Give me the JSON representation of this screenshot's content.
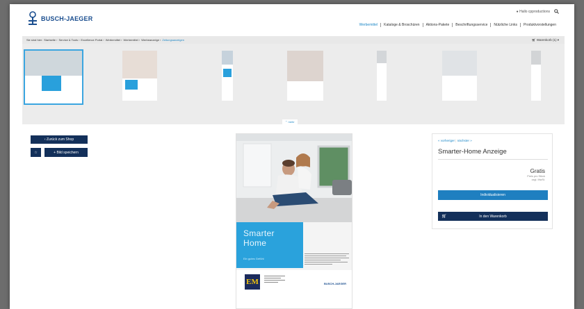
{
  "brand": {
    "name": "BUSCH-JAEGER",
    "color": "#1a4e8f"
  },
  "user": {
    "greeting": "Hallo cpproductions",
    "icon": "user-icon",
    "search_icon": "search-icon"
  },
  "main_nav": [
    {
      "label": "Werbemittel",
      "active": true
    },
    {
      "label": "Kataloge & Broschüren",
      "active": false
    },
    {
      "label": "Aktions-Pakete",
      "active": false
    },
    {
      "label": "Beschriftungsservice",
      "active": false
    },
    {
      "label": "Nützliche Links",
      "active": false
    },
    {
      "label": "Produktvorstellungen",
      "active": false
    }
  ],
  "breadcrumb": [
    {
      "label": "Sie sind hier:"
    },
    {
      "label": "Startseite ›"
    },
    {
      "label": "Service & Tools ›"
    },
    {
      "label": "Excellence Portal ›"
    },
    {
      "label": "Werbemittel ›"
    },
    {
      "label": "Werbemittel ›"
    },
    {
      "label": "Werbeanzeige ›"
    },
    {
      "label": "Zeitungsanzeigen",
      "current": true
    }
  ],
  "cart_top": "Warenkorb (1) ▾",
  "more_label": "⌃ mehr",
  "left_buttons": {
    "back": "‹ Zurück zum Shop",
    "star": "☆",
    "save": "+ Bild speichern"
  },
  "ad": {
    "headline_1": "Smarter",
    "headline_2": "Home",
    "tagline": "Ein gutes Gefühl",
    "em_logo": "EM",
    "brand_small": "BUSCH-JAEGER"
  },
  "product": {
    "prev_label": "« vorheriger",
    "next_label": "nächster »",
    "title": "Smarter-Home Anzeige",
    "price": "Gratis",
    "price_note_1": "Preis pro Stück",
    "price_note_2": "zzgl. MwSt.",
    "customize_button": "Individualisieren",
    "cart_button": "In den Warenkorb"
  },
  "colors": {
    "accent": "#1e88c7",
    "navy": "#13305a",
    "ad_blue": "#2aa2dc"
  }
}
